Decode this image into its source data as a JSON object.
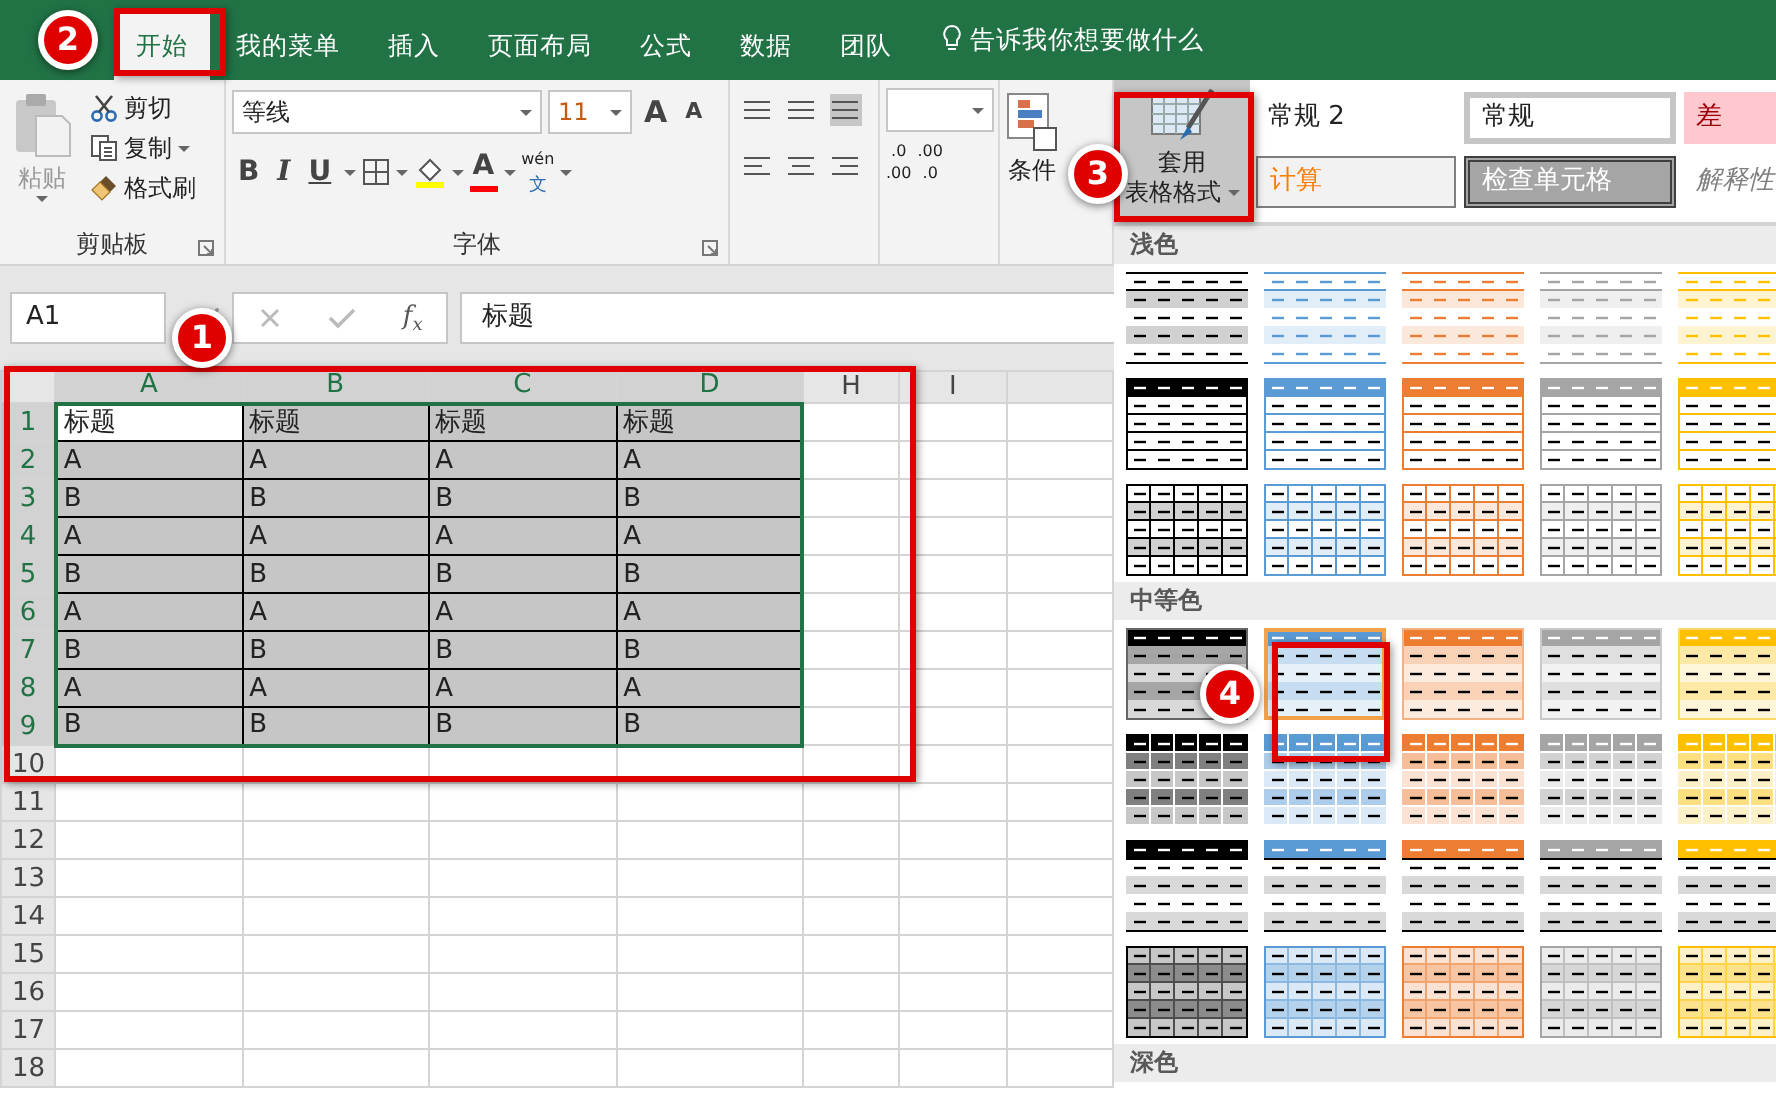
{
  "tabs": [
    {
      "label": "开始",
      "selected": true
    },
    {
      "label": "我的菜单",
      "selected": false
    },
    {
      "label": "插入",
      "selected": false
    },
    {
      "label": "页面布局",
      "selected": false
    },
    {
      "label": "公式",
      "selected": false
    },
    {
      "label": "数据",
      "selected": false
    },
    {
      "label": "团队",
      "selected": false
    }
  ],
  "tell_me": "告诉我你想要做什么",
  "clipboard": {
    "paste": "粘贴",
    "cut": "剪切",
    "copy": "复制",
    "format_painter": "格式刷",
    "group_label": "剪贴板"
  },
  "font": {
    "name": "等线",
    "size": "11",
    "grow": "A",
    "shrink": "A",
    "bold": "B",
    "italic": "I",
    "underline": "U",
    "color_letter": "A",
    "phonetic_top": "wén",
    "phonetic_bottom": "文",
    "group_label": "字体"
  },
  "number": {
    "increase_decimal": [
      ".0",
      ".00"
    ],
    "decrease_decimal": [
      ".00",
      ".0"
    ]
  },
  "conditional_format": "条件",
  "format_as_table": {
    "line_1": "套用",
    "line_2": "表格格式"
  },
  "cell_styles": [
    {
      "label": "常规 2",
      "kind": "normal"
    },
    {
      "label": "常规",
      "kind": "current"
    },
    {
      "label": "差",
      "kind": "bad"
    },
    {
      "label": "计算",
      "kind": "calculation"
    },
    {
      "label": "检查单元格",
      "kind": "check"
    },
    {
      "label": "解释性",
      "kind": "explanatory"
    }
  ],
  "formula_bar": {
    "name_box": "A1",
    "fx": "f$_{x}$",
    "formula": "标题"
  },
  "sheet": {
    "columns": [
      {
        "label": "A",
        "selected": true
      },
      {
        "label": "B",
        "selected": true
      },
      {
        "label": "C",
        "selected": true
      },
      {
        "label": "D",
        "selected": true
      },
      {
        "label": "H",
        "selected": false
      },
      {
        "label": "I",
        "selected": false
      }
    ],
    "rows": [
      {
        "number": "1",
        "selected": true,
        "active": true,
        "cells": [
          "标题",
          "标题",
          "标题",
          "标题"
        ]
      },
      {
        "number": "2",
        "selected": true,
        "active": false,
        "cells": [
          "A",
          "A",
          "A",
          "A"
        ]
      },
      {
        "number": "3",
        "selected": true,
        "active": false,
        "cells": [
          "B",
          "B",
          "B",
          "B"
        ]
      },
      {
        "number": "4",
        "selected": true,
        "active": false,
        "cells": [
          "A",
          "A",
          "A",
          "A"
        ]
      },
      {
        "number": "5",
        "selected": true,
        "active": false,
        "cells": [
          "B",
          "B",
          "B",
          "B"
        ]
      },
      {
        "number": "6",
        "selected": true,
        "active": false,
        "cells": [
          "A",
          "A",
          "A",
          "A"
        ]
      },
      {
        "number": "7",
        "selected": true,
        "active": false,
        "cells": [
          "B",
          "B",
          "B",
          "B"
        ]
      },
      {
        "number": "8",
        "selected": true,
        "active": false,
        "cells": [
          "A",
          "A",
          "A",
          "A"
        ]
      },
      {
        "number": "9",
        "selected": true,
        "active": false,
        "cells": [
          "B",
          "B",
          "B",
          "B"
        ]
      },
      {
        "number": "10",
        "selected": false,
        "active": false
      },
      {
        "number": "11",
        "selected": false,
        "active": false
      },
      {
        "number": "12",
        "selected": false,
        "active": false
      },
      {
        "number": "13",
        "selected": false,
        "active": false
      },
      {
        "number": "14",
        "selected": false,
        "active": false
      },
      {
        "number": "15",
        "selected": false,
        "active": false
      },
      {
        "number": "16",
        "selected": false,
        "active": false
      },
      {
        "number": "17",
        "selected": false,
        "active": false
      },
      {
        "number": "18",
        "selected": false,
        "active": false
      }
    ]
  },
  "gallery": {
    "sections": [
      {
        "title": "浅色",
        "rows": [
          {
            "kind": "banded",
            "swatches": [
              {
                "color": "#000000",
                "selected": false
              },
              {
                "color": "#5b9bd5",
                "selected": false
              },
              {
                "color": "#ed7d31",
                "selected": false
              },
              {
                "color": "#a5a5a5",
                "selected": false
              },
              {
                "color": "#ffc000",
                "selected": false
              }
            ]
          },
          {
            "kind": "header",
            "swatches": [
              {
                "color": "#000000",
                "selected": false
              },
              {
                "color": "#5b9bd5",
                "selected": false
              },
              {
                "color": "#ed7d31",
                "selected": false
              },
              {
                "color": "#a5a5a5",
                "selected": false
              },
              {
                "color": "#ffc000",
                "selected": false
              }
            ]
          },
          {
            "kind": "grid",
            "swatches": [
              {
                "color": "#000000",
                "selected": false
              },
              {
                "color": "#5b9bd5",
                "selected": false
              },
              {
                "color": "#ed7d31",
                "selected": false
              },
              {
                "color": "#a5a5a5",
                "selected": false
              },
              {
                "color": "#ffc000",
                "selected": false
              }
            ]
          }
        ]
      },
      {
        "title": "中等色",
        "rows": [
          {
            "kind": "medium",
            "swatches": [
              {
                "color": "#000000",
                "selected": false
              },
              {
                "color": "#5b9bd5",
                "selected": true
              },
              {
                "color": "#ed7d31",
                "selected": false
              },
              {
                "color": "#a5a5a5",
                "selected": false
              },
              {
                "color": "#ffc000",
                "selected": false
              }
            ]
          },
          {
            "kind": "medium-grid",
            "swatches": [
              {
                "color": "#000000",
                "selected": false
              },
              {
                "color": "#5b9bd5",
                "selected": false
              },
              {
                "color": "#ed7d31",
                "selected": false
              },
              {
                "color": "#a5a5a5",
                "selected": false
              },
              {
                "color": "#ffc000",
                "selected": false
              }
            ]
          },
          {
            "kind": "stripe",
            "swatches": [
              {
                "color": "#000000",
                "selected": false
              },
              {
                "color": "#5b9bd5",
                "selected": false
              },
              {
                "color": "#ed7d31",
                "selected": false
              },
              {
                "color": "#a5a5a5",
                "selected": false
              },
              {
                "color": "#ffc000",
                "selected": false
              }
            ]
          },
          {
            "kind": "shaded-grid",
            "swatches": [
              {
                "color": "#000000",
                "selected": false
              },
              {
                "color": "#5b9bd5",
                "selected": false
              },
              {
                "color": "#ed7d31",
                "selected": false
              },
              {
                "color": "#a5a5a5",
                "selected": false
              },
              {
                "color": "#ffc000",
                "selected": false
              }
            ]
          }
        ]
      },
      {
        "title": "深色"
      }
    ]
  },
  "annotations": [
    {
      "number": "1"
    },
    {
      "number": "2"
    },
    {
      "number": "3"
    },
    {
      "number": "4"
    }
  ]
}
